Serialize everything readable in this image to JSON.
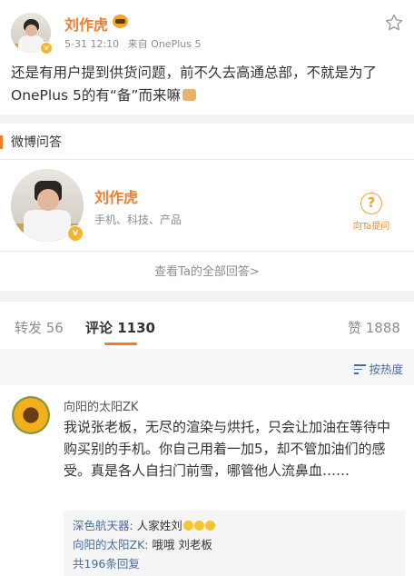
{
  "post": {
    "author": "刘作虎",
    "date": "5-31 12:10",
    "source": "来自 OnePlus 5",
    "text": "还是有用户提到供货问题，前不久去高通总部，不就是为了OnePlus 5的有“备”而来嘛"
  },
  "qa": {
    "section_title": "微博问答",
    "name": "刘作虎",
    "description": "手机、科技、产品",
    "ask_label": "向Ta提问",
    "more_link": "查看Ta的全部回答>"
  },
  "tabs": {
    "repost": "转发 56",
    "comments": "评论 1130",
    "likes": "赞 1888"
  },
  "sort": {
    "label": "按热度"
  },
  "comment": {
    "author": "向阳的太阳ZK",
    "text": "我说张老板，无尽的渲染与烘托，只会让加油在等待中购买别的手机。你自己用着一加5，却不管加油们的感受。真是各人自扫门前雪，哪管他人流鼻血……",
    "replies": [
      {
        "name": "深色航天器:",
        "text": " 人家姓刘"
      },
      {
        "name": "向阳的太阳ZK:",
        "text": " 哦哦  刘老板"
      }
    ],
    "more_replies": "共196条回复"
  },
  "colors": {
    "accent": "#f07c2a",
    "link": "#4a6d9b",
    "muted": "#8d8d8d"
  }
}
